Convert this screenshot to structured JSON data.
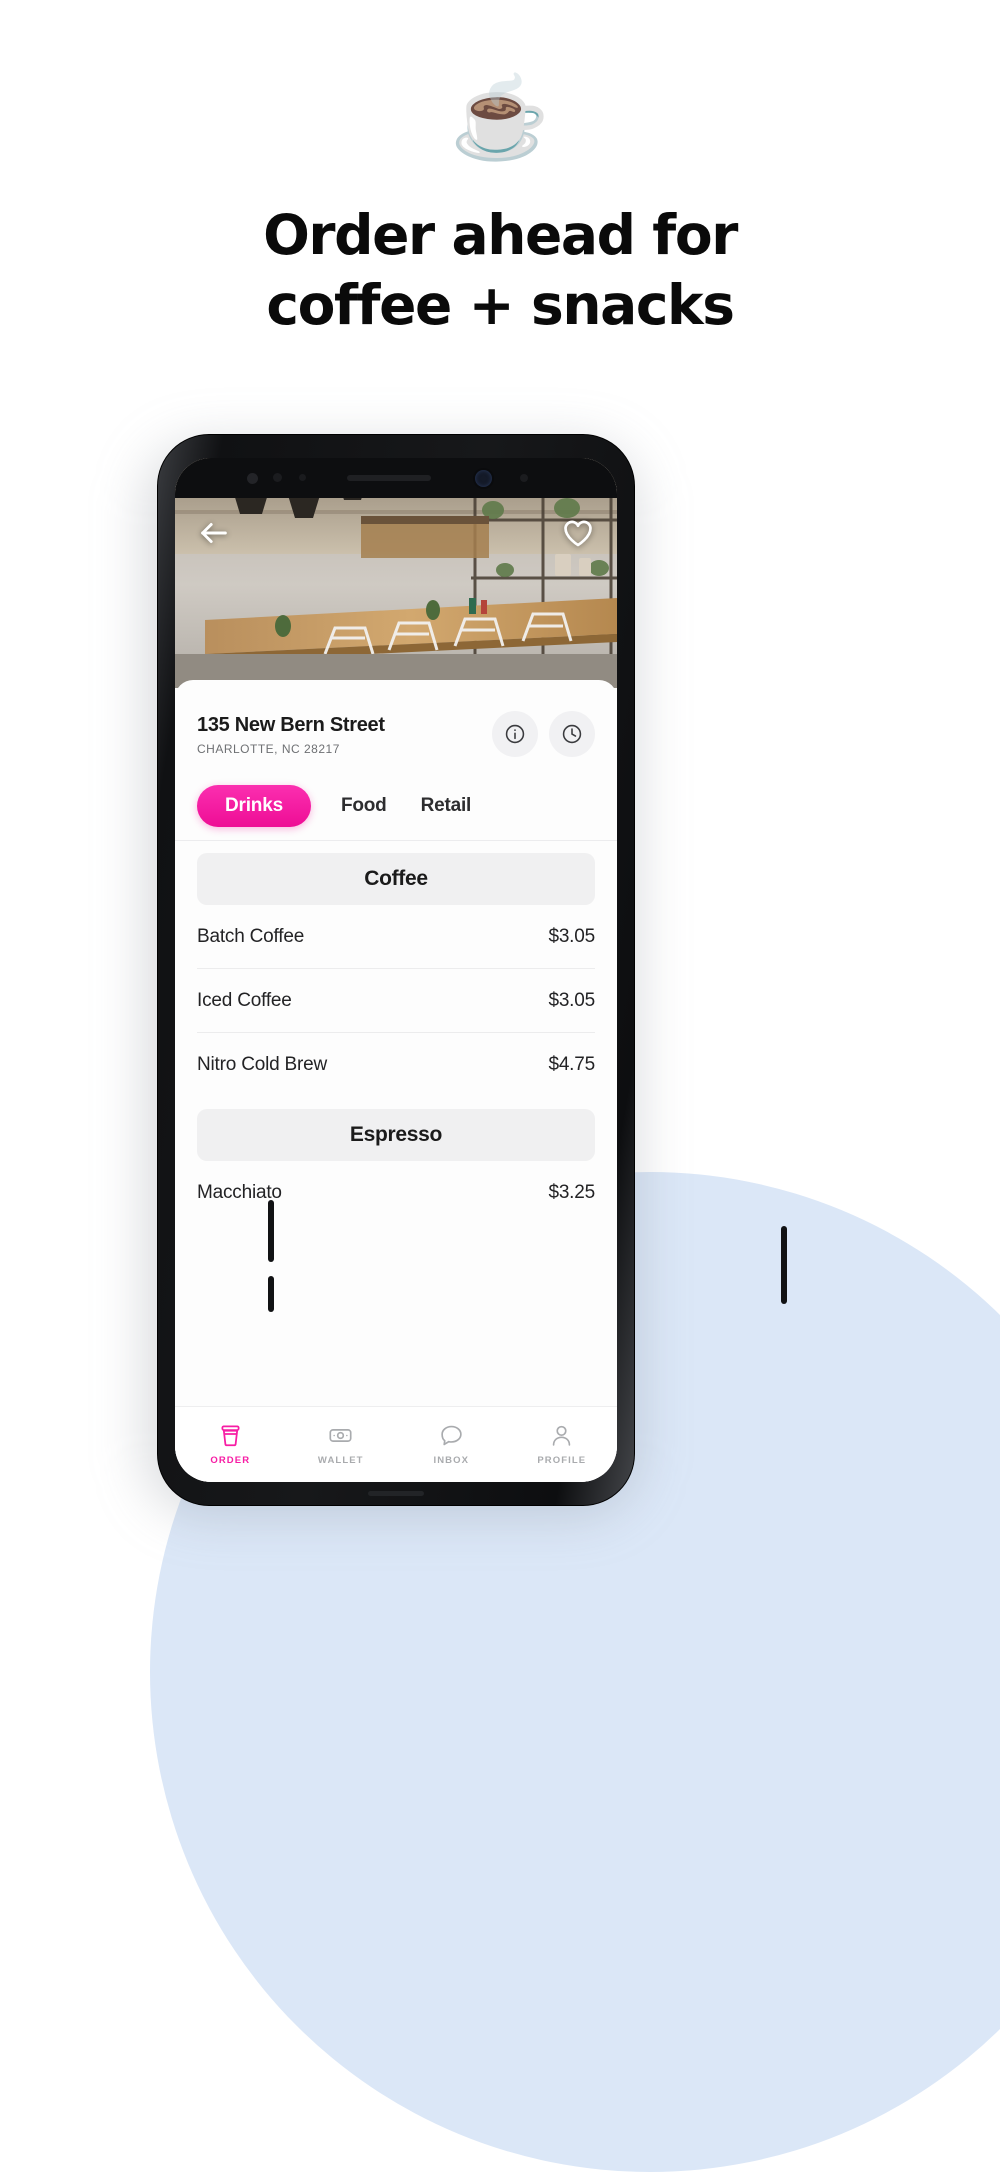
{
  "promo": {
    "emoji_icon": "hot-beverage-emoji",
    "headline_line1": "Order ahead for",
    "headline_line2": "coffee + snacks",
    "accent_color": "#f71ca4",
    "background_color": "#ffffff",
    "blob_color": "#dbe7f7"
  },
  "app": {
    "hero": {
      "back_icon": "back-arrow-icon",
      "favorite_icon": "heart-icon"
    },
    "store": {
      "address": "135 New Bern Street",
      "city_state_zip": "CHARLOTTE, NC 28217",
      "info_icon": "info-icon",
      "hours_icon": "clock-icon"
    },
    "tabs": [
      {
        "label": "Drinks",
        "active": true
      },
      {
        "label": "Food",
        "active": false
      },
      {
        "label": "Retail",
        "active": false
      }
    ],
    "menu": [
      {
        "section": "Coffee",
        "items": [
          {
            "name": "Batch Coffee",
            "price": "$3.05"
          },
          {
            "name": "Iced Coffee",
            "price": "$3.05"
          },
          {
            "name": "Nitro Cold Brew",
            "price": "$4.75"
          }
        ]
      },
      {
        "section": "Espresso",
        "items": [
          {
            "name": "Macchiato",
            "price": "$3.25"
          }
        ]
      }
    ],
    "bottom_nav": [
      {
        "label": "ORDER",
        "icon": "coffee-cup-icon",
        "active": true
      },
      {
        "label": "WALLET",
        "icon": "banknote-icon",
        "active": false
      },
      {
        "label": "INBOX",
        "icon": "chat-bubble-icon",
        "active": false
      },
      {
        "label": "PROFILE",
        "icon": "person-icon",
        "active": false
      }
    ]
  }
}
